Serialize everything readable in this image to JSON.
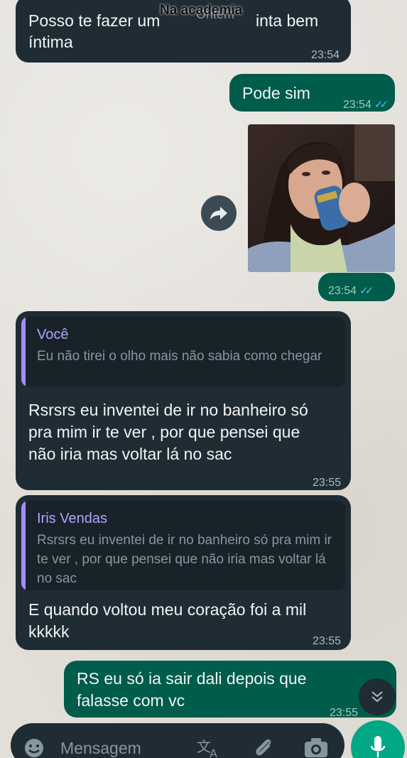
{
  "header": {
    "chat_title": "Na academia",
    "date_chip": "Ontem"
  },
  "messages": [
    {
      "text_line1": "Posso te fazer um",
      "text_line1_end": "inta bem",
      "text_line2": "íntima",
      "time": "23:54"
    },
    {
      "text": "Pode sim",
      "time": "23:54"
    },
    {
      "time": "23:54"
    },
    {
      "quote_name": "Você",
      "quote_text": "Eu não tirei o olho mais não sabia como chegar",
      "text": "Rsrsrs eu inventei de ir no banheiro só pra mim ir te ver , por que pensei que não iria mas voltar lá no sac",
      "time": "23:55"
    },
    {
      "quote_name": "Iris Vendas",
      "quote_text": "Rsrsrs eu inventei de ir no banheiro só pra mim ir te ver , por que pensei que não iria mas voltar lá no sac",
      "text": "E quando voltou meu coração foi a mil kkkkk",
      "time": "23:55"
    },
    {
      "text": "RS eu só ia sair dali depois que falasse com vc",
      "time": "23:55"
    }
  ],
  "composer": {
    "placeholder": "Mensagem"
  },
  "icons": {
    "emoji": "emoji-icon",
    "translate": "translate-icon",
    "attach": "paperclip-icon",
    "camera": "camera-icon",
    "mic": "mic-icon",
    "forward": "forward-icon",
    "scroll_down": "chevron-double-down-icon"
  },
  "colors": {
    "incoming_bubble": "#1f2c34",
    "outgoing_bubble": "#005c4b",
    "read_ticks": "#53bdeb",
    "quote_accent": "#a78bfa",
    "mic_button": "#00a884"
  }
}
